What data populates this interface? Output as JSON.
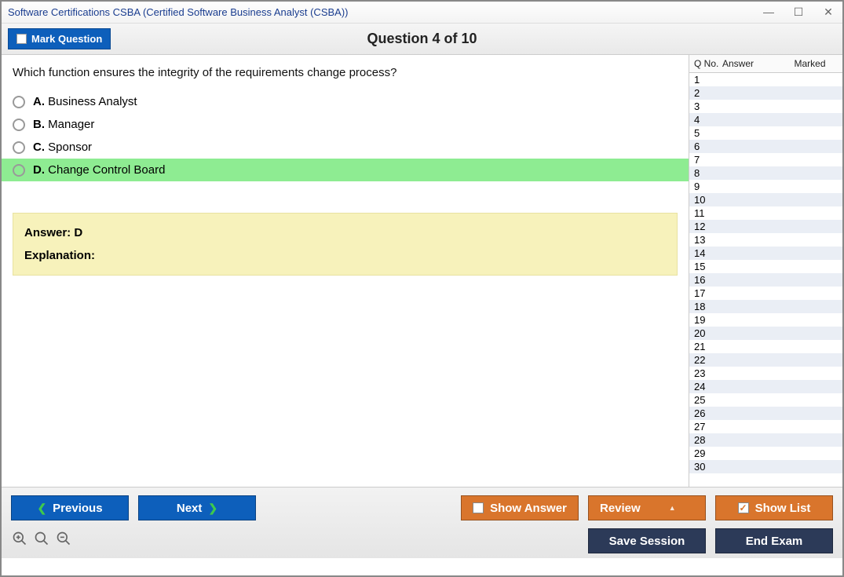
{
  "window": {
    "title": "Software Certifications CSBA (Certified Software Business Analyst (CSBA))"
  },
  "topband": {
    "mark_label": "Mark Question",
    "question_header": "Question 4 of 10"
  },
  "question": {
    "text": "Which function ensures the integrity of the requirements change process?",
    "options": [
      {
        "letter": "A.",
        "text": "Business Analyst",
        "correct": false
      },
      {
        "letter": "B.",
        "text": "Manager",
        "correct": false
      },
      {
        "letter": "C.",
        "text": "Sponsor",
        "correct": false
      },
      {
        "letter": "D.",
        "text": "Change Control Board",
        "correct": true
      }
    ],
    "answer_line": "Answer: D",
    "explanation_label": "Explanation:",
    "explanation_body": ""
  },
  "qlist": {
    "headers": {
      "qno": "Q No.",
      "answer": "Answer",
      "marked": "Marked"
    },
    "rows": [
      {
        "n": "1"
      },
      {
        "n": "2"
      },
      {
        "n": "3"
      },
      {
        "n": "4"
      },
      {
        "n": "5"
      },
      {
        "n": "6"
      },
      {
        "n": "7"
      },
      {
        "n": "8"
      },
      {
        "n": "9"
      },
      {
        "n": "10"
      },
      {
        "n": "11"
      },
      {
        "n": "12"
      },
      {
        "n": "13"
      },
      {
        "n": "14"
      },
      {
        "n": "15"
      },
      {
        "n": "16"
      },
      {
        "n": "17"
      },
      {
        "n": "18"
      },
      {
        "n": "19"
      },
      {
        "n": "20"
      },
      {
        "n": "21"
      },
      {
        "n": "22"
      },
      {
        "n": "23"
      },
      {
        "n": "24"
      },
      {
        "n": "25"
      },
      {
        "n": "26"
      },
      {
        "n": "27"
      },
      {
        "n": "28"
      },
      {
        "n": "29"
      },
      {
        "n": "30"
      }
    ]
  },
  "footer": {
    "previous": "Previous",
    "next": "Next",
    "show_answer": "Show Answer",
    "review": "Review",
    "show_list": "Show List",
    "save_session": "Save Session",
    "end_exam": "End Exam"
  }
}
